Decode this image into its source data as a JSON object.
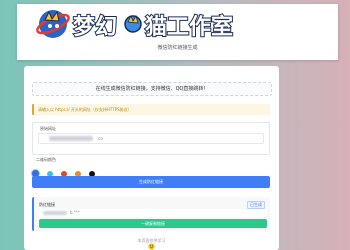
{
  "header": {
    "logo_text": "梦幻·猫工作室",
    "subtitle": "微信防红链接生成"
  },
  "card": {
    "notice": "在线生成微信防红链接，支持微信、QQ直接跳转！",
    "warning": "请输入以 https:// 开头的网址（仅支持HTTPS协议）",
    "url_field": {
      "label": "原始网址",
      "value_suffix": ".cn"
    },
    "colors_label": "二维码颜色",
    "swatches": [
      "#2f6fe0",
      "#3cc0e8",
      "#e8432f",
      "#f08a1a",
      "#111111"
    ],
    "generate_button": "生成防红链接",
    "result": {
      "title": "防红链接",
      "tag": "已生成",
      "link_suffix": "b.***",
      "copy_button": "一键复制链接"
    },
    "footer": "本页面仅供学习"
  }
}
